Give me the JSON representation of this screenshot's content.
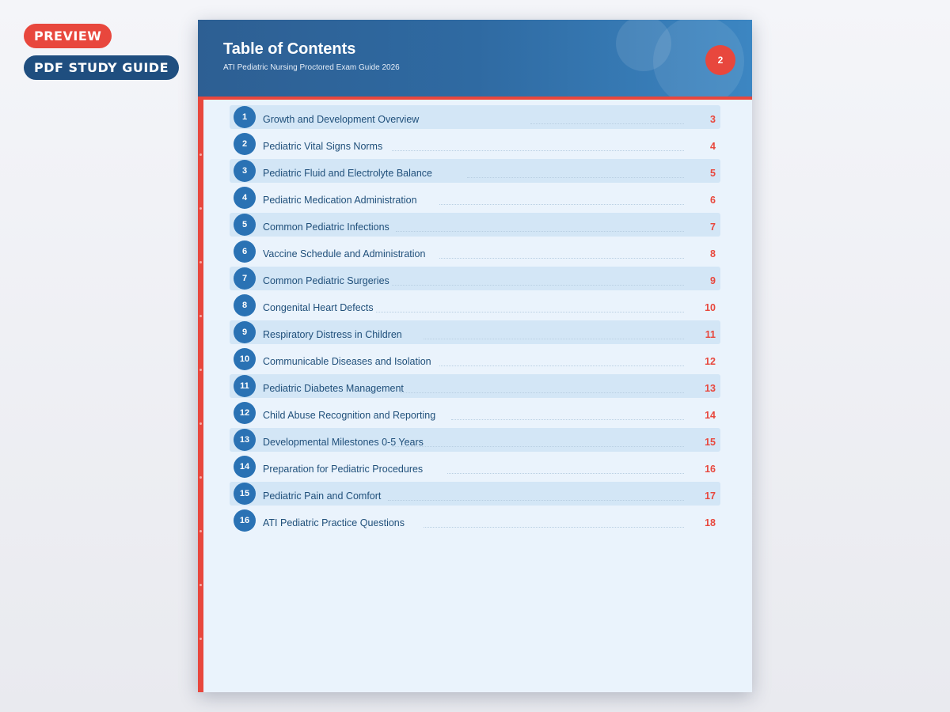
{
  "badges": {
    "preview": "PREVIEW",
    "study_guide": "PDF STUDY GUIDE"
  },
  "page": {
    "title": "Table of Contents",
    "subtitle": "ATI Pediatric Nursing Proctored Exam Guide 2026",
    "page_number": "2"
  },
  "colors": {
    "accent_red": "#e8473d",
    "header_blue": "#2f6aa2",
    "number_circle_blue": "#2a72b4",
    "row_shade": "#d3e6f6",
    "page_bg": "#eaf3fc"
  },
  "toc": [
    {
      "num": "1",
      "title": "Growth and Development Overview",
      "page": "3"
    },
    {
      "num": "2",
      "title": "Pediatric Vital Signs Norms",
      "page": "4"
    },
    {
      "num": "3",
      "title": "Pediatric Fluid and Electrolyte Balance",
      "page": "5"
    },
    {
      "num": "4",
      "title": "Pediatric Medication Administration",
      "page": "6"
    },
    {
      "num": "5",
      "title": "Common Pediatric Infections",
      "page": "7"
    },
    {
      "num": "6",
      "title": "Vaccine Schedule and Administration",
      "page": "8"
    },
    {
      "num": "7",
      "title": "Common Pediatric Surgeries",
      "page": "9"
    },
    {
      "num": "8",
      "title": "Congenital Heart Defects",
      "page": "10"
    },
    {
      "num": "9",
      "title": "Respiratory Distress in Children",
      "page": "11"
    },
    {
      "num": "10",
      "title": "Communicable Diseases and Isolation",
      "page": "12"
    },
    {
      "num": "11",
      "title": "Pediatric Diabetes Management",
      "page": "13"
    },
    {
      "num": "12",
      "title": "Child Abuse Recognition and Reporting",
      "page": "14"
    },
    {
      "num": "13",
      "title": "Developmental Milestones 0-5 Years",
      "page": "15"
    },
    {
      "num": "14",
      "title": "Preparation for Pediatric Procedures",
      "page": "16"
    },
    {
      "num": "15",
      "title": "Pediatric Pain and Comfort",
      "page": "17"
    },
    {
      "num": "16",
      "title": "ATI Pediatric Practice Questions",
      "page": "18"
    }
  ]
}
